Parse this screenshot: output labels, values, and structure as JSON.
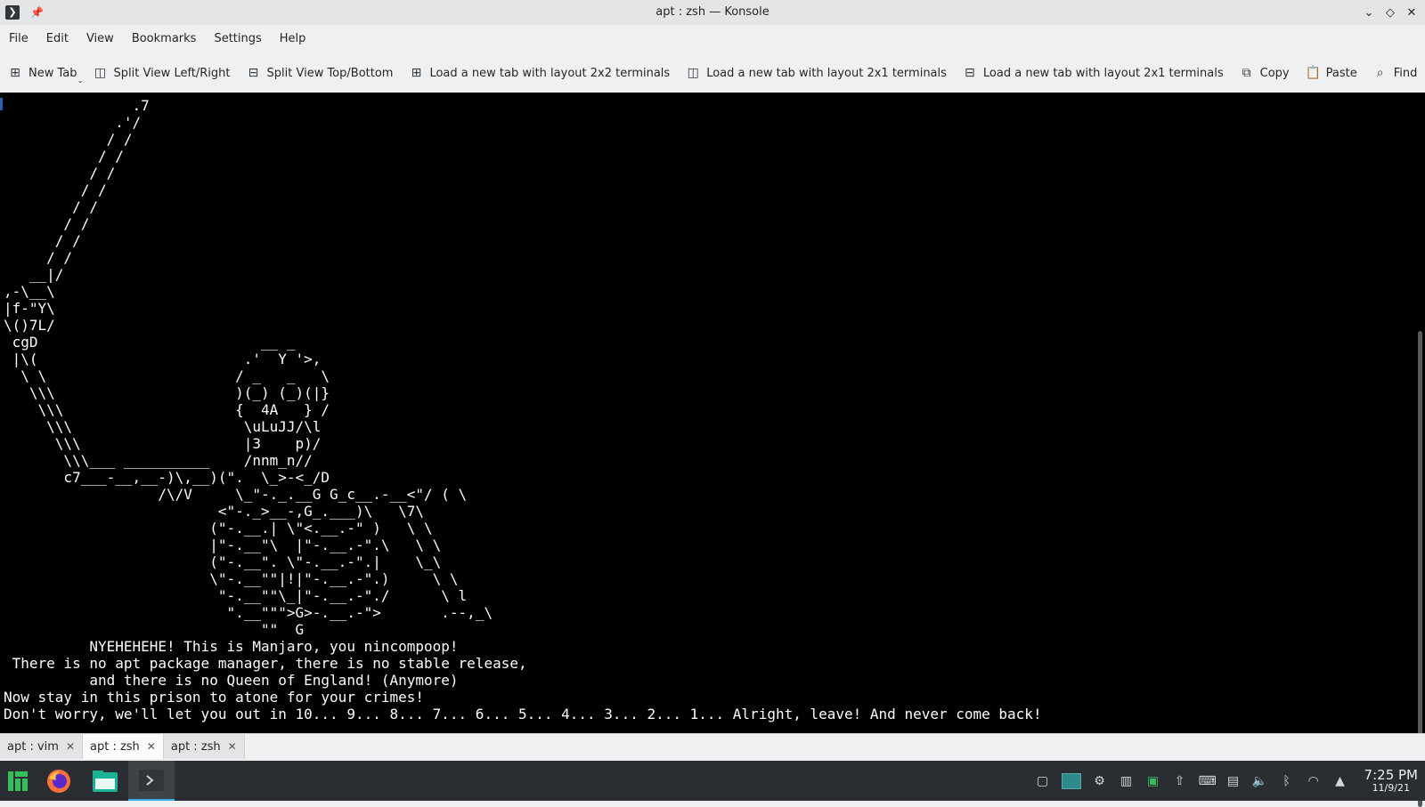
{
  "window": {
    "title": "apt : zsh — Konsole",
    "app_icon": "terminal-prompt-icon",
    "controls": [
      "minimize",
      "maximize",
      "close"
    ]
  },
  "menubar": {
    "items": [
      "File",
      "Edit",
      "View",
      "Bookmarks",
      "Settings",
      "Help"
    ]
  },
  "toolbar": {
    "new_tab": "New Tab",
    "split_lr": "Split View Left/Right",
    "split_tb": "Split View Top/Bottom",
    "layout_2x2": "Load a new tab with layout 2x2 terminals",
    "layout_2x1_a": "Load a new tab with layout 2x1 terminals",
    "layout_2x1_b": "Load a new tab with layout 2x1 terminals",
    "copy": "Copy",
    "paste": "Paste",
    "find": "Find"
  },
  "terminal": {
    "lines": [
      "               .7",
      "             .'/",
      "            / /",
      "           / /",
      "          / /",
      "         / /",
      "        / /",
      "       / /",
      "      / /",
      "     / /",
      "   __|/",
      ",-\\__\\",
      "|f-\"Y\\",
      "\\()7L/",
      " cgD                          __ _",
      " |\\(                        .'  Y '>,",
      "  \\ \\                      / _   _   \\",
      "   \\\\\\                     )(_) (_)(|}",
      "    \\\\\\                    {  4A   } /",
      "     \\\\\\                    \\uLuJJ/\\l",
      "      \\\\\\                   |3    p)/",
      "       \\\\\\___ __________    /nnm_n//",
      "       c7___-__,__-)\\,__)(\".  \\_>-<_/D",
      "                  /\\/V     \\_\"-._.__G G_c__.-__<\"/ ( \\",
      "                         <\"-._>__-,G_.___)\\   \\7\\",
      "                        (\"-.__.| \\\"<.__.-\" )   \\ \\",
      "                        |\"-.__\"\\  |\"-.__.-\".\\   \\ \\",
      "                        (\"-.__\". \\\"-.__.-\".|    \\_\\",
      "                        \\\"-.__\"\"|!|\"-.__.-\".)     \\ \\",
      "                         \"-.__\"\"\\_|\"-.__.-\"./      \\ l",
      "                          \".__\"\"\">G>-.__.-\">       .--,_\\",
      "                              \"\"  G",
      "          NYEHEHEHE! This is Manjaro, you nincompoop!",
      " There is no apt package manager, there is no stable release,",
      "          and there is no Queen of England! (Anymore)",
      "Now stay in this prison to atone for your crimes!",
      "Don't worry, we'll let you out in 10... 9... 8... 7... 6... 5... 4... 3... 2... 1... Alright, leave! And never come back!"
    ]
  },
  "tabs": [
    {
      "label": "apt : vim",
      "active": false
    },
    {
      "label": "apt : zsh",
      "active": true
    },
    {
      "label": "apt : zsh",
      "active": false
    }
  ],
  "taskbar": {
    "launcher_icon": "manjaro-logo-icon",
    "tasks": [
      "firefox-icon",
      "file-manager-icon",
      "konsole-icon"
    ],
    "tray_icons": [
      "desktop-1-icon",
      "desktop-2-icon",
      "network-settings-icon",
      "activity-icon",
      "package-updates-icon",
      "update-arrow-icon",
      "terminal-icon",
      "clipboard-icon",
      "volume-icon",
      "bluetooth-icon",
      "wifi-icon",
      "show-hidden-icon"
    ],
    "clock_time": "7:25 PM",
    "clock_date": "11/9/21"
  }
}
